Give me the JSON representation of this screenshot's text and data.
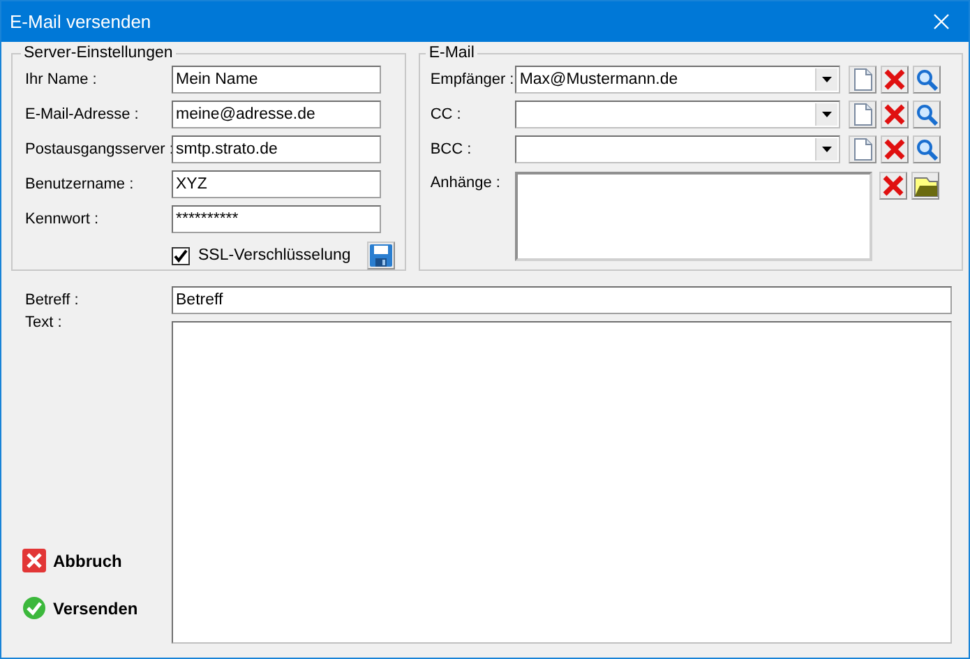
{
  "window": {
    "title": "E-Mail versenden"
  },
  "server_settings": {
    "title": "Server-Einstellungen",
    "fields": [
      {
        "label": "Ihr Name :",
        "value": "Mein Name"
      },
      {
        "label": "E-Mail-Adresse :",
        "value": "meine@adresse.de"
      },
      {
        "label": "Postausgangsserver :",
        "value": "smtp.strato.de"
      },
      {
        "label": "Benutzername :",
        "value": "XYZ"
      },
      {
        "label": "Kennwort :",
        "value": "**********"
      }
    ],
    "ssl": {
      "label": "SSL-Verschlüsselung",
      "checked": true
    }
  },
  "email": {
    "title": "E-Mail",
    "recipients": [
      {
        "label": "Empfänger :",
        "value": "Max@Mustermann.de"
      },
      {
        "label": "CC :"
      },
      {
        "label": "BCC :"
      }
    ],
    "attachments": {
      "label": "Anhänge :"
    }
  },
  "subject": {
    "label": "Betreff :",
    "value": "Betreff"
  },
  "text": {
    "label": "Text :"
  },
  "buttons": [
    {
      "label": "Abbruch",
      "kind": "cancel"
    },
    {
      "label": "Versenden",
      "kind": "send"
    }
  ]
}
